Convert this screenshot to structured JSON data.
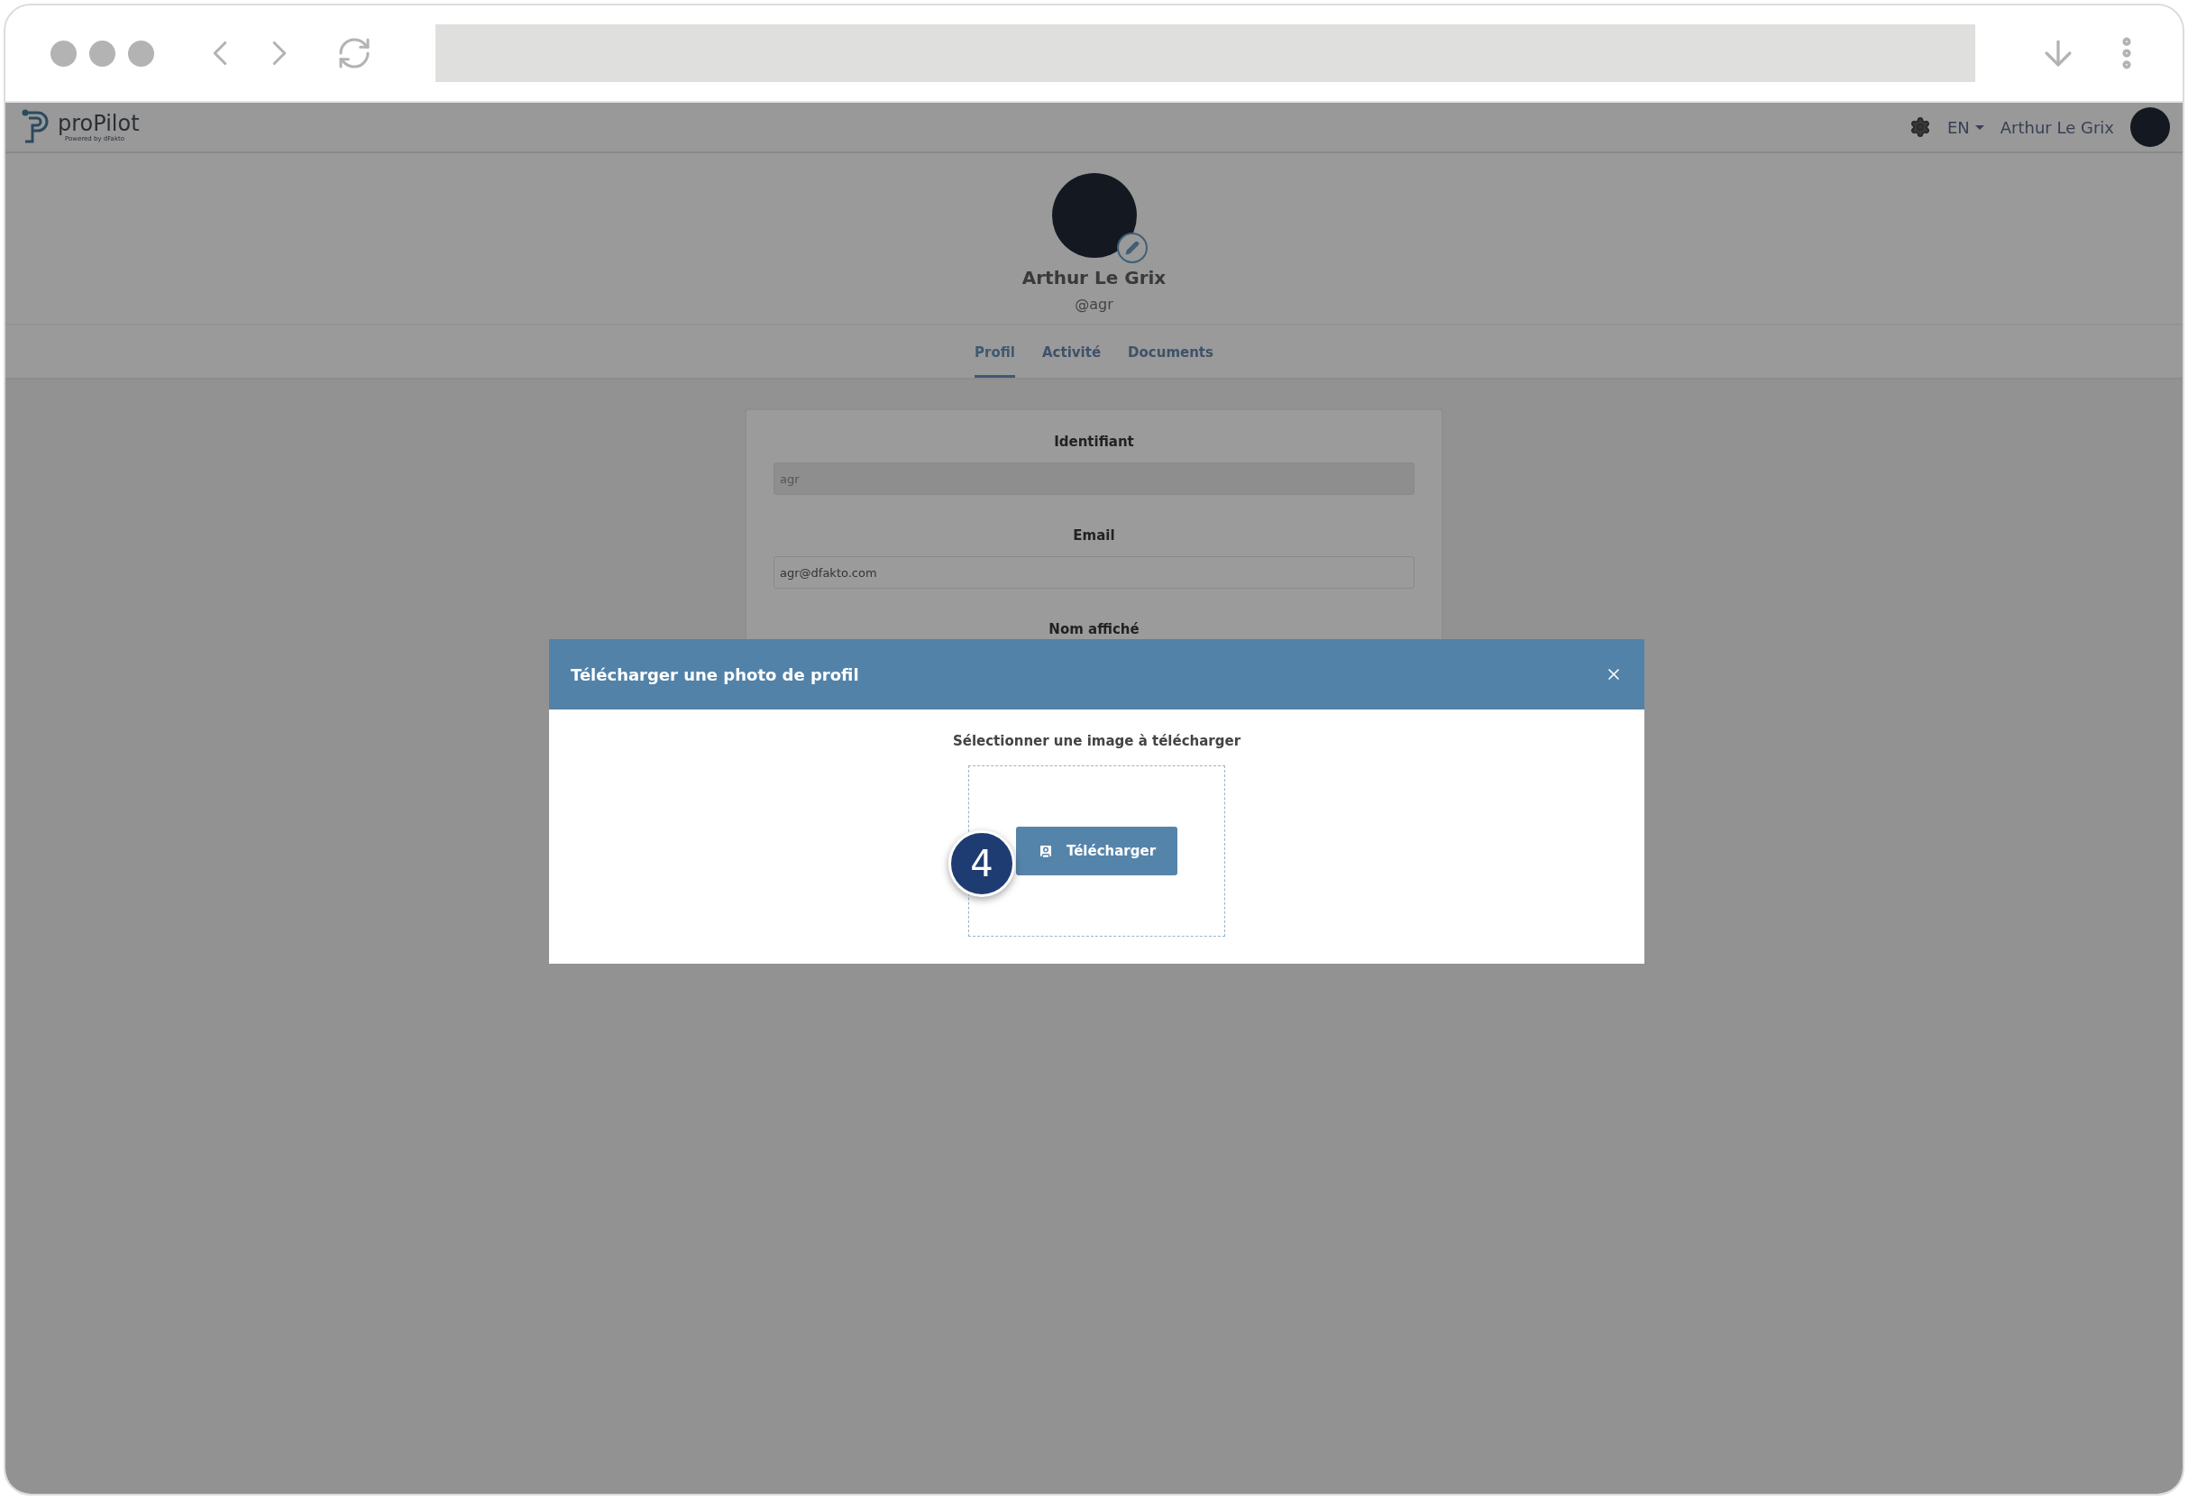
{
  "header": {
    "logo": "proPilot",
    "logo_tagline": "Powered by dFakto",
    "language": "EN",
    "user_name": "Arthur Le Grix"
  },
  "profile": {
    "name": "Arthur Le Grix",
    "handle": "@agr"
  },
  "tabs": [
    {
      "label": "Profil",
      "selected": true
    },
    {
      "label": "Activité",
      "selected": false
    },
    {
      "label": "Documents",
      "selected": false
    }
  ],
  "form": {
    "fields": [
      {
        "label": "Identifiant",
        "value": "agr",
        "disabled": true
      },
      {
        "label": "Email",
        "value": "agr@dfakto.com",
        "disabled": false
      }
    ],
    "covered_label": "Nom affiché"
  },
  "modal": {
    "title": "Télécharger une photo de profil",
    "prompt": "Sélectionner une image à télécharger",
    "button": "Télécharger"
  },
  "step_badge": "4"
}
